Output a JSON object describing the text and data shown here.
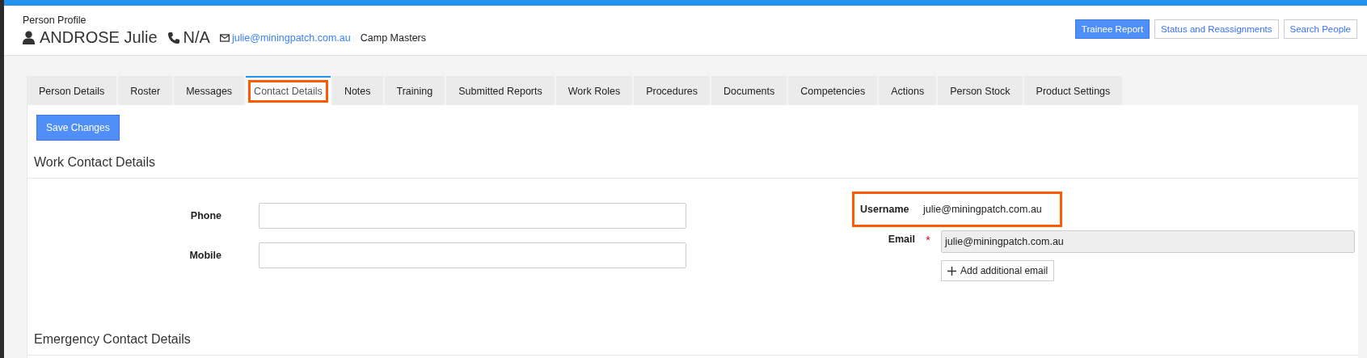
{
  "header": {
    "subtitle": "Person Profile",
    "name": "ANDROSE Julie",
    "phone": "N/A",
    "email": "julie@miningpatch.com.au",
    "company": "Camp Masters"
  },
  "header_buttons": [
    {
      "label": "Trainee Report",
      "primary": true
    },
    {
      "label": "Status and Reassignments",
      "primary": false
    },
    {
      "label": "Search People",
      "primary": false
    }
  ],
  "tabs": [
    {
      "label": "Person Details",
      "selected": false,
      "highlighted": false
    },
    {
      "label": "Roster",
      "selected": false,
      "highlighted": false
    },
    {
      "label": "Messages",
      "selected": false,
      "highlighted": false
    },
    {
      "label": "Contact Details",
      "selected": true,
      "highlighted": true
    },
    {
      "label": "Notes",
      "selected": false,
      "highlighted": false
    },
    {
      "label": "Training",
      "selected": false,
      "highlighted": false
    },
    {
      "label": "Submitted Reports",
      "selected": false,
      "highlighted": false
    },
    {
      "label": "Work Roles",
      "selected": false,
      "highlighted": false
    },
    {
      "label": "Procedures",
      "selected": false,
      "highlighted": false
    },
    {
      "label": "Documents",
      "selected": false,
      "highlighted": false
    },
    {
      "label": "Competencies",
      "selected": false,
      "highlighted": false
    },
    {
      "label": "Actions",
      "selected": false,
      "highlighted": false
    },
    {
      "label": "Person Stock",
      "selected": false,
      "highlighted": false
    },
    {
      "label": "Product Settings",
      "selected": false,
      "highlighted": false
    }
  ],
  "save_button": "Save Changes",
  "work_section": {
    "title": "Work Contact Details",
    "left_fields": [
      {
        "label": "Phone"
      },
      {
        "label": "Mobile"
      }
    ],
    "username": {
      "label": "Username",
      "value": "julie@miningpatch.com.au",
      "highlighted": true
    },
    "email": {
      "label": "Email",
      "required": true,
      "required_mark": "*",
      "value": "julie@miningpatch.com.au",
      "disabled": true
    },
    "add_email_button": "Add additional email"
  },
  "emergency_section": {
    "title": "Emergency Contact Details"
  }
}
